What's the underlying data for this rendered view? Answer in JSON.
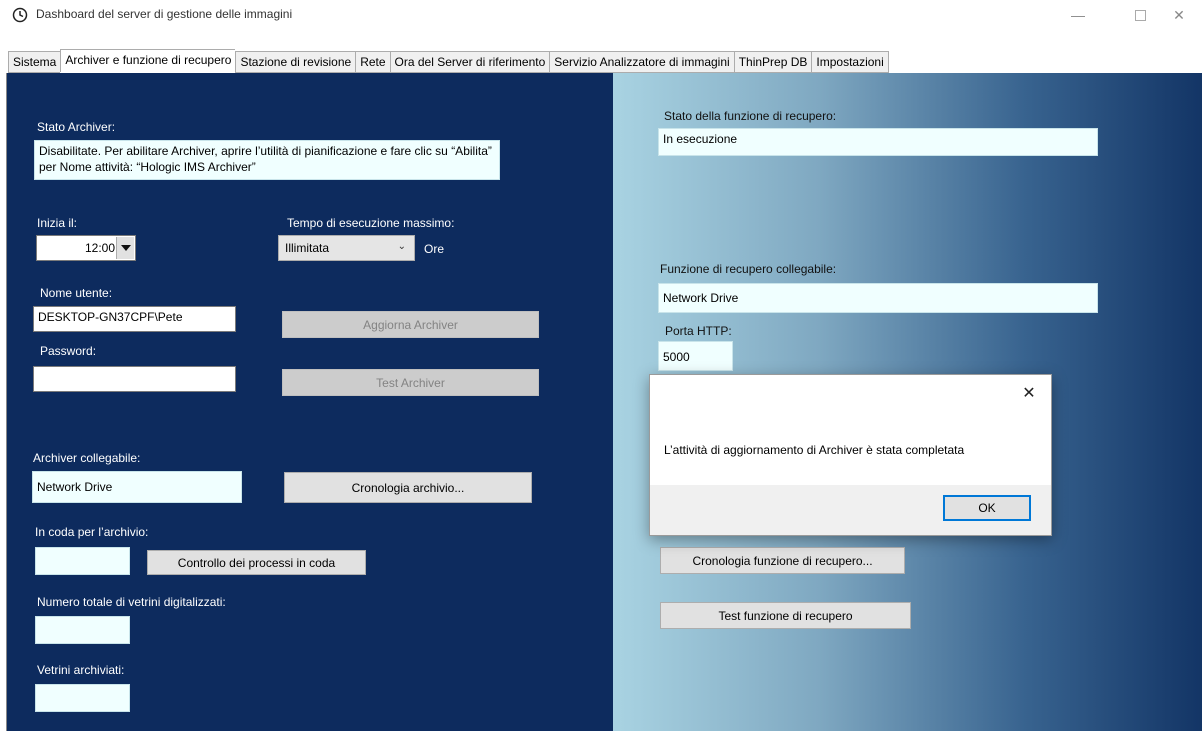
{
  "window": {
    "title": "Dashboard del server di gestione delle immagini",
    "controls": {
      "minimize": "—",
      "close": "✕"
    }
  },
  "tabs": [
    {
      "label": "Sistema",
      "active": false
    },
    {
      "label": "Archiver e funzione di recupero",
      "active": true
    },
    {
      "label": "Stazione di revisione",
      "active": false
    },
    {
      "label": "Rete",
      "active": false
    },
    {
      "label": "Ora del Server di riferimento",
      "active": false
    },
    {
      "label": "Servizio Analizzatore di immagini",
      "active": false
    },
    {
      "label": "ThinPrep DB",
      "active": false
    },
    {
      "label": "Impostazioni",
      "active": false
    }
  ],
  "left": {
    "stato_archiver": {
      "label": "Stato Archiver:",
      "value": "Disabilitate. Per abilitare Archiver, aprire l’utilità di pianificazione e fare clic su “Abilita” per Nome attività: “Hologic IMS Archiver”"
    },
    "inizia": {
      "label": "Inizia il:",
      "value": "12:00"
    },
    "tempo": {
      "label": "Tempo di esecuzione massimo:",
      "value": "Illimitata",
      "unit": "Ore"
    },
    "nome_utente": {
      "label": "Nome utente:",
      "value": "DESKTOP-GN37CPF\\Pete"
    },
    "password": {
      "label": "Password:",
      "value": ""
    },
    "aggiorna_button": "Aggiorna Archiver",
    "test_button": "Test Archiver",
    "archiver_collegabile": {
      "label": "Archiver collegabile:",
      "value": "Network Drive"
    },
    "cronologia_button": "Cronologia archivio...",
    "in_coda": {
      "label": "In coda per l’archivio:",
      "value": ""
    },
    "controllo_button": "Controllo dei processi in coda",
    "numero_totale": {
      "label": "Numero totale di vetrini digitalizzati:",
      "value": ""
    },
    "vetrini": {
      "label": "Vetrini archiviati:",
      "value": ""
    }
  },
  "right": {
    "stato_recupero": {
      "label": "Stato della funzione di recupero:",
      "value": "In esecuzione"
    },
    "funzione_collegabile": {
      "label": "Funzione di recupero collegabile:",
      "value": "Network Drive"
    },
    "porta_http": {
      "label": "Porta HTTP:",
      "value": "5000"
    },
    "cronologia_recupero_button": "Cronologia funzione di recupero...",
    "test_recupero_button": "Test funzione di recupero"
  },
  "dialog": {
    "message": "L’attività di aggiornamento di Archiver è stata completata",
    "ok_label": "OK",
    "close_glyph": "✕"
  },
  "colors": {
    "left_panel_bg": "#0d2b5e",
    "field_bg": "#f0ffff",
    "accent": "#0078d7"
  }
}
